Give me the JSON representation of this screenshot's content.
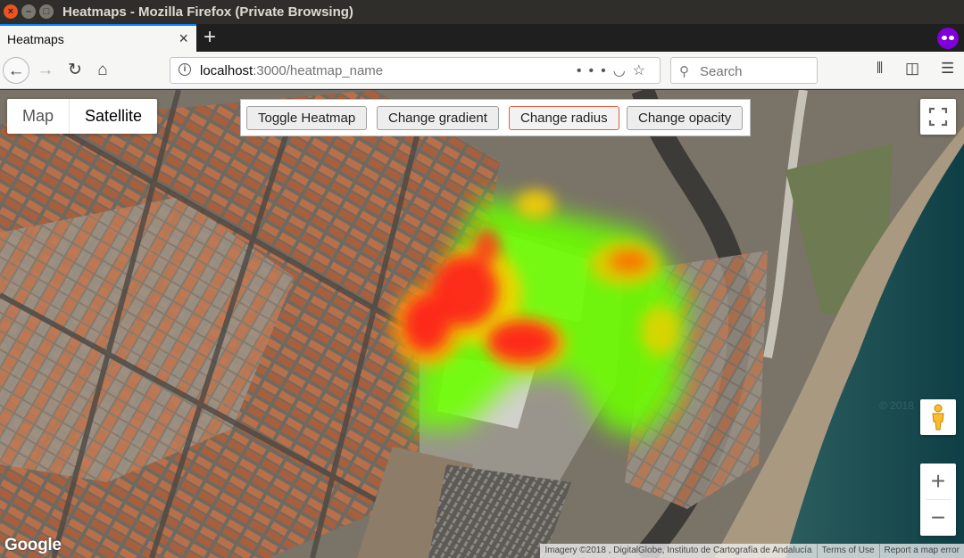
{
  "window": {
    "title": "Heatmaps - Mozilla Firefox (Private Browsing)"
  },
  "tabs": [
    {
      "title": "Heatmaps"
    }
  ],
  "url": {
    "host": "localhost",
    "path": ":3000/heatmap_name"
  },
  "search": {
    "placeholder": "Search"
  },
  "map_type": {
    "options": [
      "Map",
      "Satellite"
    ],
    "selected": "Satellite"
  },
  "panel": {
    "buttons": [
      "Toggle Heatmap",
      "Change gradient",
      "Change radius",
      "Change opacity"
    ],
    "focused": "Change radius"
  },
  "footer": {
    "logo": "Google",
    "imagery": "Imagery ©2018 , DigitalGlobe, Instituto de Cartografía de Andalucía",
    "terms": "Terms of Use",
    "report": "Report a map error",
    "watermark": "© 2018"
  },
  "zoom": {
    "in": "+",
    "out": "−"
  },
  "colors": {
    "heat_low": "#66ff00",
    "heat_mid": "#ffcc00",
    "heat_high": "#ff0000",
    "sea": "#10484f",
    "roof": "#b86c47"
  },
  "icons": [
    "close-icon",
    "minimize-icon",
    "maximize-icon",
    "private-browsing-icon",
    "back-icon",
    "forward-icon",
    "reload-icon",
    "home-icon",
    "info-icon",
    "page-actions-icon",
    "pocket-icon",
    "bookmark-star-icon",
    "search-icon",
    "library-icon",
    "sidebar-icon",
    "menu-icon",
    "fullscreen-icon",
    "pegman-icon"
  ]
}
